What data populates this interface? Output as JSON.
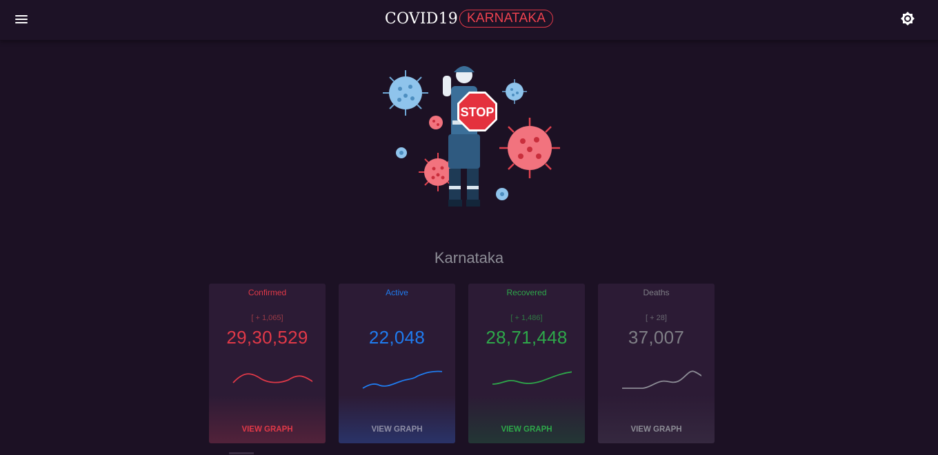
{
  "header": {
    "title": "COVID19",
    "state_badge": "KARNATAKA",
    "menu_icon": "hamburger-menu-icon",
    "theme_icon": "brightness-icon"
  },
  "hero": {
    "illustration": "worker-holding-stop-sign-with-virus-particles",
    "sign_text": "STOP"
  },
  "region": {
    "title": "Karnataka"
  },
  "cards": [
    {
      "label": "Confirmed",
      "delta": "[ + 1,065]",
      "value": "29,30,529",
      "link": "VIEW GRAPH",
      "color": "#e13948"
    },
    {
      "label": "Active",
      "delta": "",
      "value": "22,048",
      "link": "VIEW GRAPH",
      "color": "#1f7cf0"
    },
    {
      "label": "Recovered",
      "delta": "[ + 1,486]",
      "value": "28,71,448",
      "link": "VIEW GRAPH",
      "color": "#2ea84a"
    },
    {
      "label": "Deaths",
      "delta": "[ + 28]",
      "value": "37,007",
      "link": "VIEW GRAPH",
      "color": "#7f7f86"
    }
  ],
  "colors": {
    "background": "#1c1124",
    "accent_red": "#e13948",
    "link_active": "#8f8fa6",
    "link_deaths": "#8d8d96"
  }
}
